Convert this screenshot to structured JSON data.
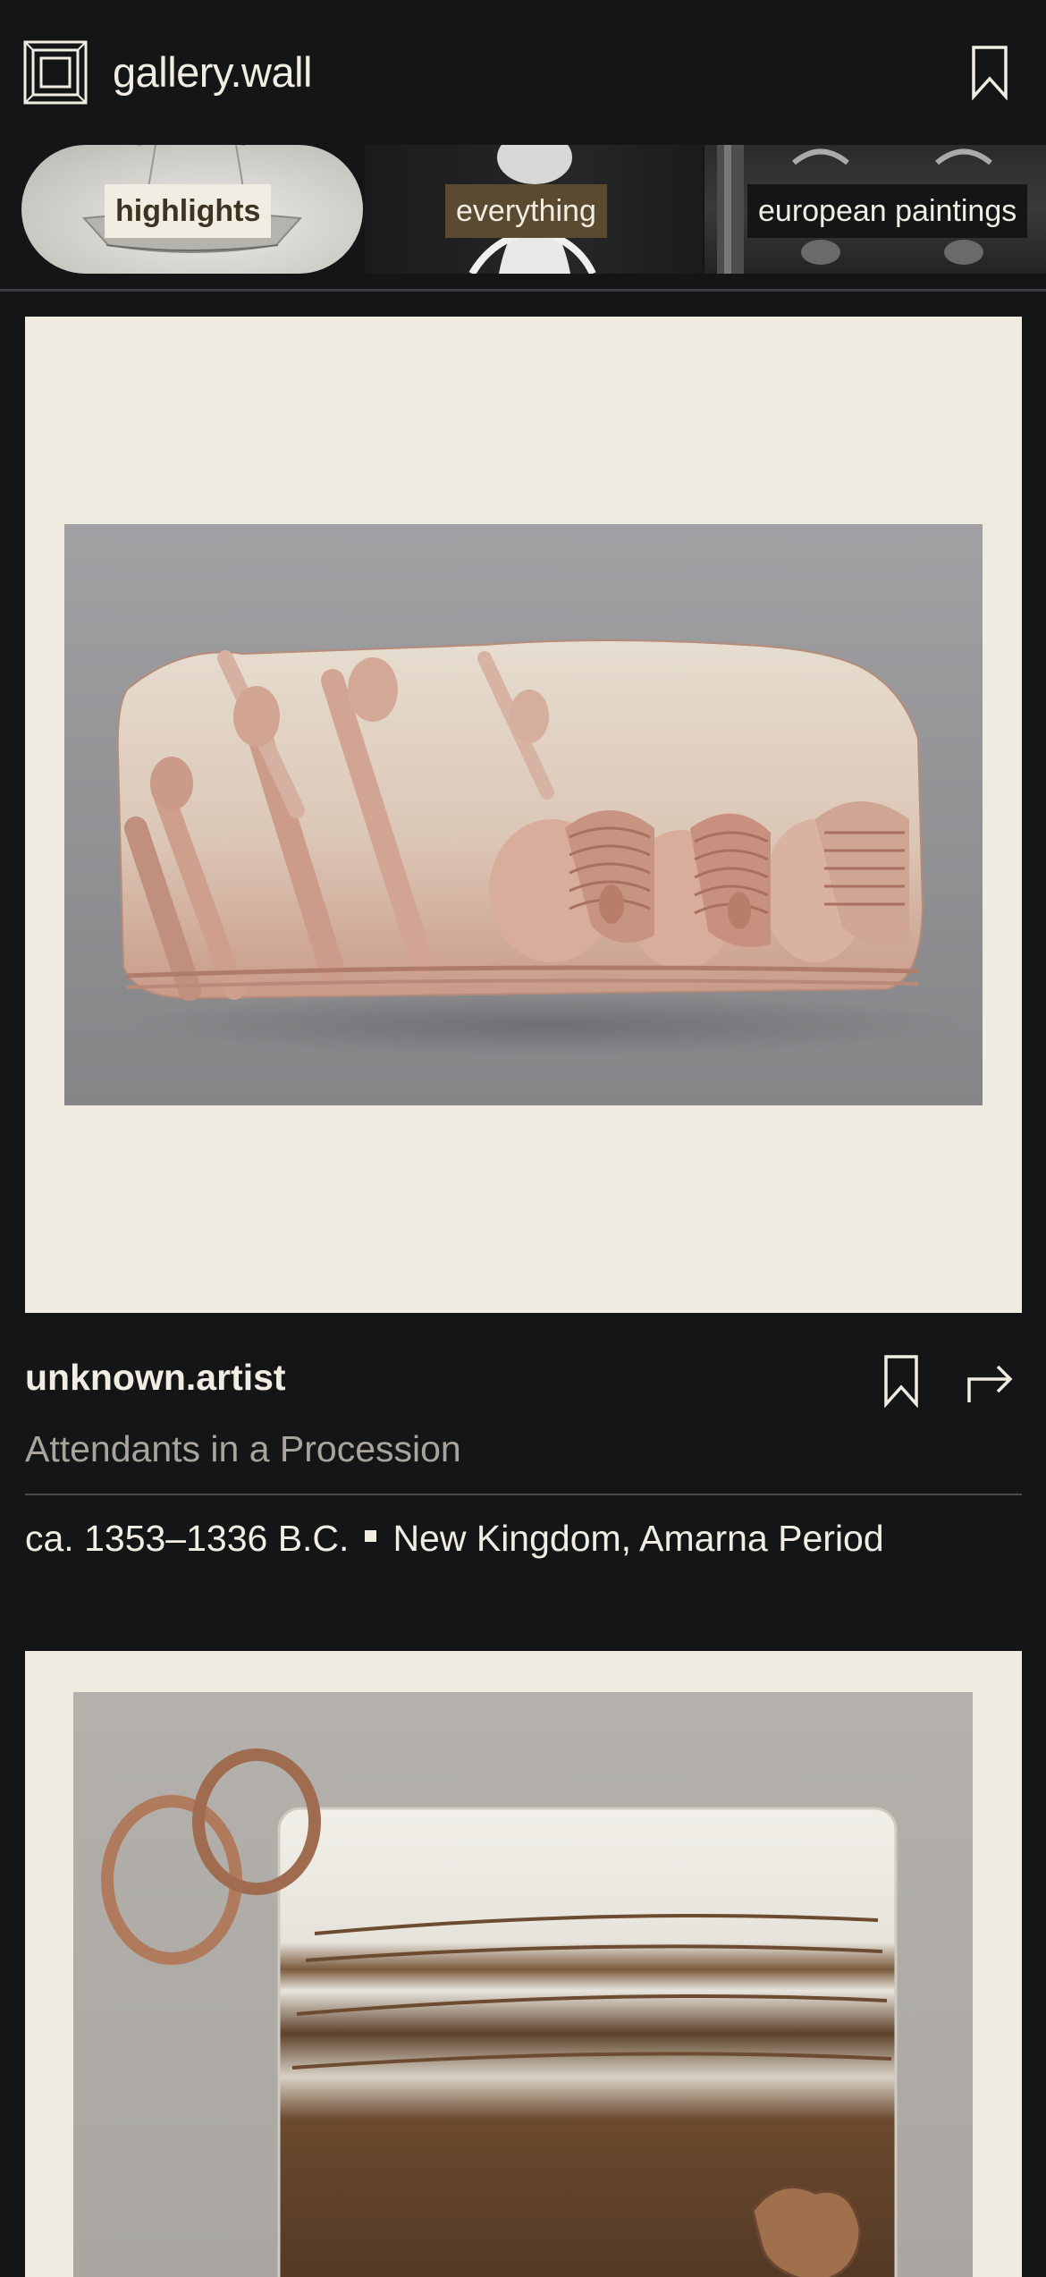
{
  "app": {
    "title": "gallery.wall"
  },
  "categories": [
    {
      "label": "highlights",
      "selected": true
    },
    {
      "label": "everything",
      "selected": false
    },
    {
      "label": "european paintings",
      "selected": false
    }
  ],
  "artworks": [
    {
      "artist": "unknown.artist",
      "title": "Attendants in a Procession",
      "date": "ca. 1353–1336 B.C.",
      "period": "New Kingdom, Amarna Period"
    }
  ],
  "icons": {
    "logo": "frame-logo-icon",
    "header_bookmark": "bookmark-icon",
    "card_bookmark": "bookmark-icon",
    "share": "share-arrow-icon"
  },
  "colors": {
    "background": "#141517",
    "text": "#f1ede3",
    "muted_text": "#a9a59c",
    "frame": "#f0ebe1",
    "accent": "#5a4a30"
  }
}
